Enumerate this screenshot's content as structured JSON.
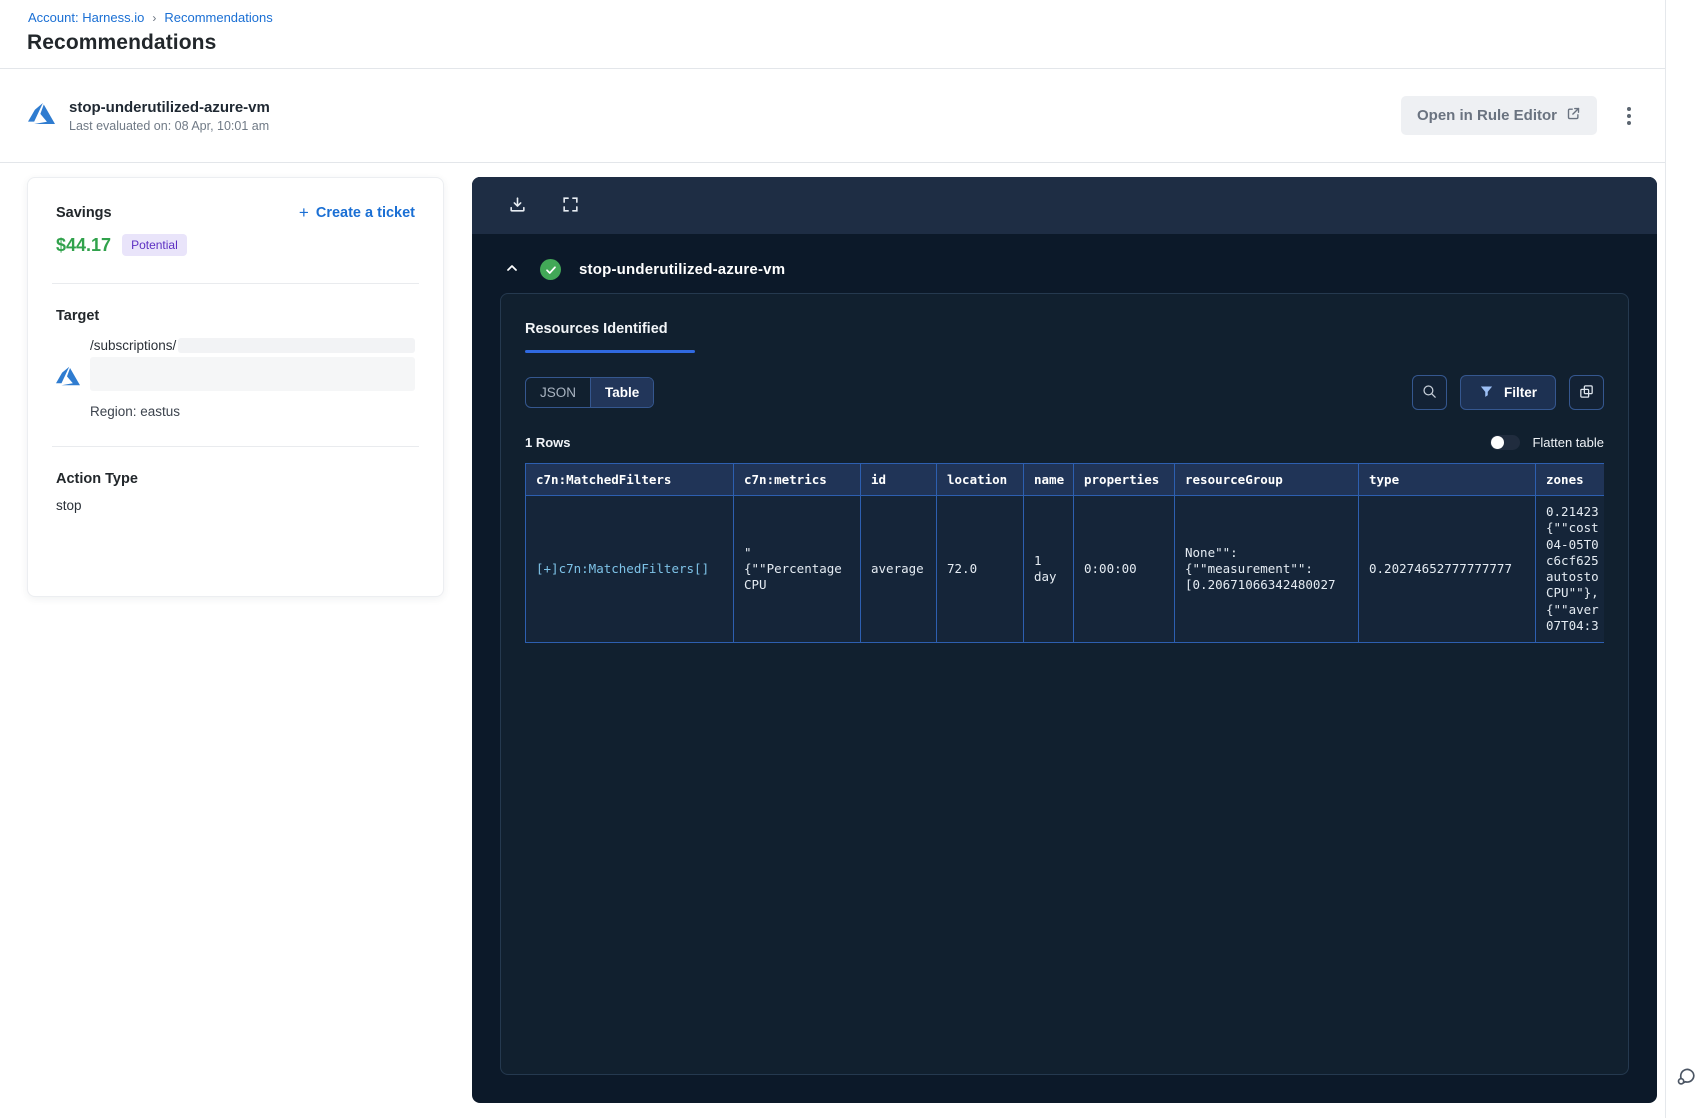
{
  "breadcrumb": {
    "account": "Account: Harness.io",
    "separator": "›",
    "current": "Recommendations"
  },
  "page_title": "Recommendations",
  "header": {
    "title": "stop-underutilized-azure-vm",
    "subtitle": "Last evaluated on: 08 Apr, 10:01 am",
    "open_rule_editor": "Open in Rule Editor"
  },
  "savings_card": {
    "savings_label": "Savings",
    "amount": "$44.17",
    "badge": "Potential",
    "create_ticket": "Create a ticket",
    "target_label": "Target",
    "target_path": "/subscriptions/",
    "region": "Region: eastus",
    "action_type_label": "Action Type",
    "action_type_value": "stop"
  },
  "panel": {
    "title": "stop-underutilized-azure-vm",
    "tab": "Resources Identified",
    "view_toggle": {
      "json": "JSON",
      "table": "Table"
    },
    "filter_label": "Filter",
    "rows_count": "1 Rows",
    "flatten_label": "Flatten table",
    "table": {
      "columns": [
        "c7n:MatchedFilters",
        "c7n:metrics",
        "id",
        "location",
        "name",
        "properties",
        "resourceGroup",
        "type",
        "zones"
      ],
      "row": {
        "matched_filters": "[+]c7n:MatchedFilters[]",
        "metrics": "\"\n{\"\"Percentage CPU",
        "id": "average",
        "location": "72.0",
        "name": "1 day",
        "properties": "0:00:00",
        "resource_group": "None\"\":\n{\"\"measurement\"\":\n[0.20671066342480027",
        "type": "0.20274652777777777",
        "zones": "0.21423\n{\"\"cost\n04-05T0\nc6cf625\nautosto\nCPU\"\"},\n{\"\"aver\n07T04:3"
      }
    }
  },
  "icons": {
    "plus": "+",
    "download": "tray-arrow-down",
    "fullscreen": "corner-brackets",
    "collapse": "chevron-up",
    "success_check": "check-circle",
    "search": "magnifier",
    "filter": "funnel",
    "copy": "overlapping-squares",
    "external_link": "box-arrow",
    "more_options": "vertical-dots",
    "chat": "speech-bubbles",
    "azure": "azure-logo"
  },
  "colors": {
    "link_blue": "#1a6fd4",
    "savings_green": "#31a24c",
    "potential_badge_bg": "#e9e4fa",
    "potential_badge_text": "#5c2fc2",
    "panel_bg": "#0c1929",
    "panel_toolbar_bg": "#1e2d44",
    "accent_blue": "#3069e0",
    "success_green": "#42a857",
    "table_border_blue": "#2d5fb0",
    "azure_blue": "#2f7cd0"
  }
}
